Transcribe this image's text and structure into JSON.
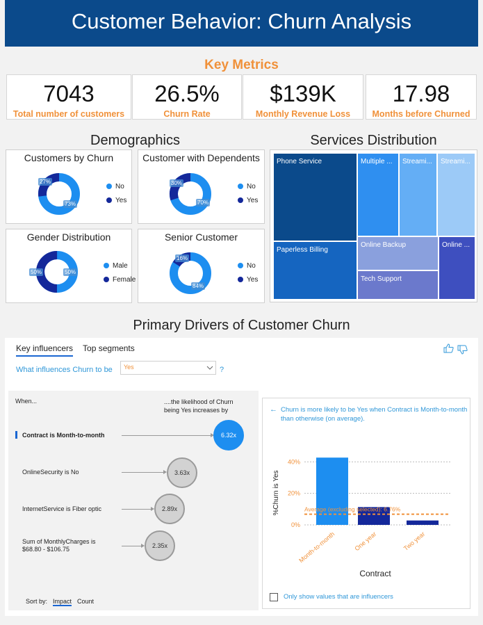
{
  "header": {
    "title": "Customer Behavior: Churn Analysis"
  },
  "key_metrics": {
    "title": "Key Metrics",
    "kpis": [
      {
        "value": "7043",
        "label": "Total number of customers"
      },
      {
        "value": "26.5%",
        "label": "Churn Rate"
      },
      {
        "value": "$139K",
        "label": "Monthly Revenue Loss"
      },
      {
        "value": "17.98",
        "label": "Months before Churned"
      }
    ]
  },
  "demographics": {
    "title": "Demographics",
    "cards": [
      {
        "title": "Customers by Churn",
        "legend": [
          "No",
          "Yes"
        ],
        "labels": [
          "27%",
          "73%"
        ],
        "split": 0.27
      },
      {
        "title": "Customer with Dependents",
        "legend": [
          "No",
          "Yes"
        ],
        "labels": [
          "30%",
          "70%"
        ],
        "split": 0.3
      },
      {
        "title": "Gender Distribution",
        "legend": [
          "Male",
          "Female"
        ],
        "labels": [
          "50%",
          "50%"
        ],
        "split": 0.5
      },
      {
        "title": "Senior Customer",
        "legend": [
          "No",
          "Yes"
        ],
        "labels": [
          "16%",
          "84%"
        ],
        "split": 0.16
      }
    ],
    "colors": {
      "primary": "#1d8ef0",
      "secondary": "#14289a"
    }
  },
  "services": {
    "title": "Services Distribution",
    "tiles": [
      "Phone Service",
      "Multiple ...",
      "Streami...",
      "Streami...",
      "Paperless Billing",
      "Online Backup",
      "Online ...",
      "Tech Support"
    ]
  },
  "drivers": {
    "title": "Primary Drivers of Customer Churn",
    "tabs": [
      "Key influencers",
      "Top segments"
    ],
    "question": "What influences Churn to be",
    "select_value": "Yes",
    "qmark": "?",
    "when": "When...",
    "likelihood": "....the likelihood of Churn being Yes increases by",
    "influencers": [
      {
        "label": "Contract is Month-to-month",
        "value": "6.32x"
      },
      {
        "label": "OnlineSecurity is No",
        "value": "3.63x"
      },
      {
        "label": "InternetService is Fiber optic",
        "value": "2.89x"
      },
      {
        "label": "Sum of MonthlyCharges is $68.80 - $106.75",
        "value": "2.35x"
      }
    ],
    "sort_label": "Sort by:",
    "sort_options": [
      "Impact",
      "Count"
    ],
    "detail": {
      "back": "←",
      "message": "Churn is more likely to be Yes when Contract is Month-to-month than otherwise (on average).",
      "checkbox_label": "Only show values that are influencers"
    }
  },
  "chart_data": {
    "type": "bar",
    "categories": [
      "Month-to-month",
      "One year",
      "Two year"
    ],
    "values": [
      42.7,
      11.3,
      2.8
    ],
    "xlabel": "Contract",
    "ylabel": "%Churn is Yes",
    "yticks": [
      "0%",
      "20%",
      "40%"
    ],
    "ylim": [
      0,
      45
    ],
    "reference_line": {
      "label": "Average (excluding selected): 6.76%",
      "value": 6.76,
      "color": "#f0913a"
    },
    "colors": [
      "#1d8ef0",
      "#14289a",
      "#14289a"
    ],
    "grid": true
  }
}
